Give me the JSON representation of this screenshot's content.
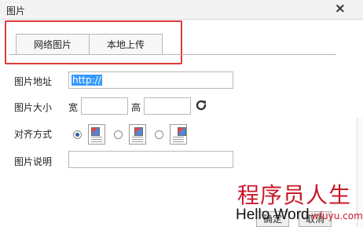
{
  "dialog": {
    "title": "图片",
    "close_symbol": "×"
  },
  "tabs": [
    {
      "label": "网络图片"
    },
    {
      "label": "本地上传"
    }
  ],
  "form": {
    "url_label": "图片地址",
    "url_value": "http://",
    "size_label": "图片大小",
    "width_label": "宽",
    "height_label": "高",
    "width_value": "",
    "height_value": "",
    "align_label": "对齐方式",
    "align_selected": "left",
    "desc_label": "图片说明",
    "desc_value": ""
  },
  "buttons": {
    "ok": "确定",
    "cancel": "取消"
  },
  "watermark": {
    "cn": "程序员人生",
    "en": "Hello Word",
    "url": "wfuyu.com"
  },
  "icons": {
    "close": "close-icon",
    "refresh": "refresh-icon",
    "align_left": "align-left-icon",
    "align_center": "align-center-icon",
    "align_right": "align-right-icon"
  },
  "colors": {
    "highlight_border": "#e0393e",
    "selection": "#3399ff",
    "watermark_red": "#c8182a"
  }
}
